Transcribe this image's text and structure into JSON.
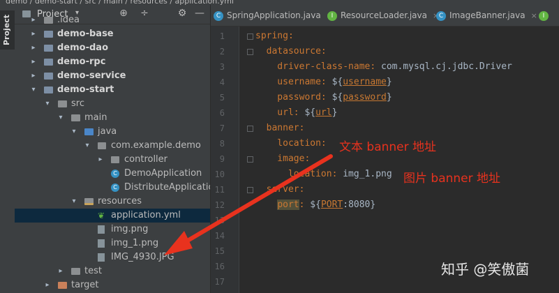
{
  "breadcrumb": [
    "demo",
    "demo-start",
    "src",
    "main",
    "resources",
    "application.yml"
  ],
  "sidebar_tab": "Project",
  "panel": {
    "title": "Project",
    "caret": "▾",
    "buttons": [
      "⊕",
      "÷",
      "⚙",
      "—"
    ]
  },
  "tree": [
    {
      "label": ".idea",
      "icon": "folder-icon",
      "bold": false,
      "arrow": "▸"
    },
    {
      "label": "demo-base",
      "icon": "module-icon",
      "bold": true,
      "arrow": "▸"
    },
    {
      "label": "demo-dao",
      "icon": "module-icon",
      "bold": true,
      "arrow": "▸"
    },
    {
      "label": "demo-rpc",
      "icon": "module-icon",
      "bold": true,
      "arrow": "▸"
    },
    {
      "label": "demo-service",
      "icon": "module-icon",
      "bold": true,
      "arrow": "▸"
    },
    {
      "label": "demo-start",
      "icon": "module-icon",
      "bold": true,
      "arrow": "▾"
    },
    {
      "label": "src",
      "icon": "folder-icon",
      "bold": false,
      "arrow": "▾"
    },
    {
      "label": "main",
      "icon": "folder-icon",
      "bold": false,
      "arrow": "▾"
    },
    {
      "label": "java",
      "icon": "java-source-folder-icon",
      "bold": false,
      "arrow": "▾"
    },
    {
      "label": "com.example.demo",
      "icon": "package-icon",
      "bold": false,
      "arrow": "▾"
    },
    {
      "label": "controller",
      "icon": "package-icon",
      "bold": false,
      "arrow": "▸"
    },
    {
      "label": "DemoApplication",
      "icon": "spring-class-icon",
      "bold": false,
      "arrow": ""
    },
    {
      "label": "DistributeApplication",
      "icon": "spring-class-icon",
      "bold": false,
      "arrow": ""
    },
    {
      "label": "resources",
      "icon": "resources-folder-icon",
      "bold": false,
      "arrow": "▾"
    },
    {
      "label": "application.yml",
      "icon": "yml-file-icon",
      "bold": false,
      "arrow": ""
    },
    {
      "label": "img.png",
      "icon": "image-file-icon",
      "bold": false,
      "arrow": ""
    },
    {
      "label": "img_1.png",
      "icon": "image-file-icon",
      "bold": false,
      "arrow": ""
    },
    {
      "label": "IMG_4930.JPG",
      "icon": "image-file-icon",
      "bold": false,
      "arrow": ""
    },
    {
      "label": "test",
      "icon": "folder-icon",
      "bold": false,
      "arrow": "▸"
    },
    {
      "label": "target",
      "icon": "target-folder-icon",
      "bold": false,
      "arrow": "▸"
    }
  ],
  "selected_file": "application.yml",
  "tabs": [
    {
      "label": "SpringApplication.java",
      "icon": "C",
      "color": "#3592c4",
      "active": false
    },
    {
      "label": "ResourceLoader.java",
      "icon": "I",
      "color": "#62b543",
      "active": false
    },
    {
      "label": "ImageBanner.java",
      "icon": "C",
      "color": "#3592c4",
      "active": false
    },
    {
      "label": "I",
      "icon": "I",
      "color": "#62b543",
      "active": false
    }
  ],
  "line_numbers": [
    "1",
    "2",
    "3",
    "4",
    "5",
    "6",
    "7",
    "8",
    "9",
    "10",
    "11",
    "12",
    "13",
    "14",
    "15",
    "16",
    "17"
  ],
  "code": [
    [
      {
        "t": "spring:",
        "c": "k"
      }
    ],
    [
      {
        "t": "  datasource:",
        "c": "k"
      }
    ],
    [
      {
        "t": "    driver-class-name: ",
        "c": "k"
      },
      {
        "t": "com.mysql.cj.jdbc.Driver",
        "c": "v"
      }
    ],
    [
      {
        "t": "    username: ",
        "c": "k"
      },
      {
        "t": "${",
        "c": "v"
      },
      {
        "t": "username",
        "c": "vu"
      },
      {
        "t": "}",
        "c": "v"
      }
    ],
    [
      {
        "t": "    password: ",
        "c": "k"
      },
      {
        "t": "${",
        "c": "v"
      },
      {
        "t": "password",
        "c": "vu"
      },
      {
        "t": "}",
        "c": "v"
      }
    ],
    [
      {
        "t": "    url: ",
        "c": "k"
      },
      {
        "t": "${",
        "c": "v"
      },
      {
        "t": "url",
        "c": "vu"
      },
      {
        "t": "}",
        "c": "v"
      }
    ],
    [
      {
        "t": "  banner:",
        "c": "k"
      }
    ],
    [
      {
        "t": "    location:",
        "c": "k"
      }
    ],
    [
      {
        "t": "    image:",
        "c": "k"
      }
    ],
    [
      {
        "t": "      location: ",
        "c": "k"
      },
      {
        "t": "img_1.png",
        "c": "v"
      }
    ],
    [
      {
        "t": "  server:",
        "c": "k"
      }
    ],
    [
      {
        "t": "    ",
        "c": "k"
      },
      {
        "t": "port",
        "c": "k hl"
      },
      {
        "t": ": ",
        "c": "k"
      },
      {
        "t": "${",
        "c": "v"
      },
      {
        "t": "PORT",
        "c": "vu"
      },
      {
        "t": ":8080}",
        "c": "v"
      }
    ],
    [],
    [],
    [],
    [],
    []
  ],
  "annotations": {
    "text_banner": "文本 banner 地址",
    "image_banner": "图片 banner 地址"
  },
  "watermark": "知乎 @笑傲菌",
  "colors": {
    "annotation": "#e8321e",
    "key": "#cc7832",
    "value": "#a9b7c6",
    "selection": "#0d293e"
  }
}
